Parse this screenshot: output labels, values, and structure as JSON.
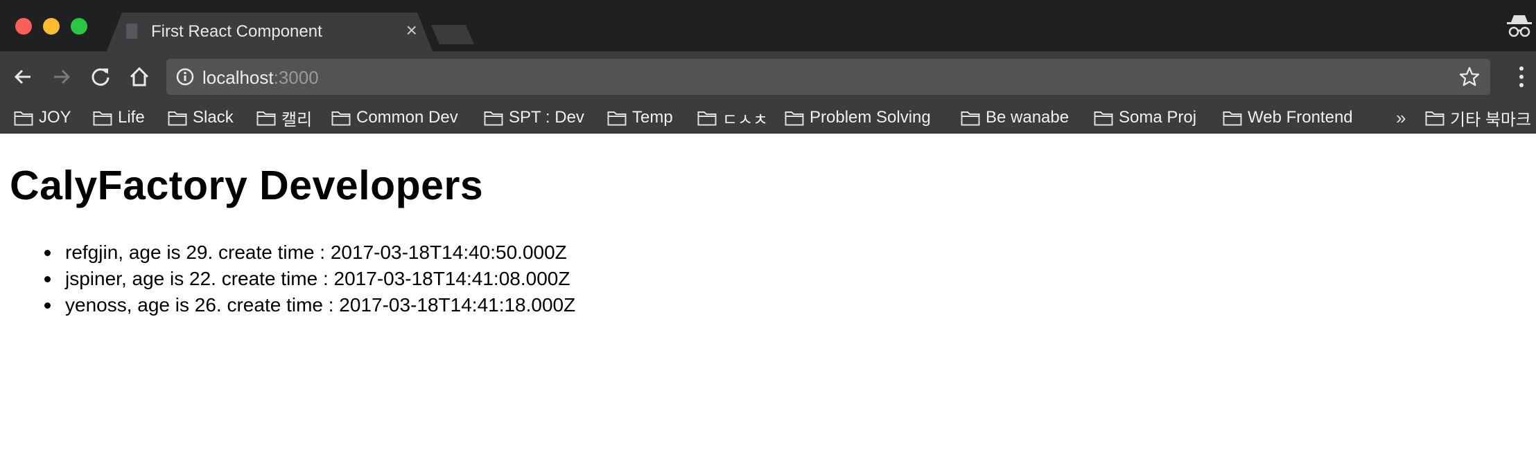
{
  "window": {
    "tab_title": "First React Component",
    "tab_close": "×"
  },
  "toolbar": {
    "url_host": "localhost",
    "url_port": ":3000"
  },
  "bookmarks": {
    "items": [
      "JOY",
      "Life",
      "Slack",
      "캘리",
      "Common Dev",
      "SPT : Dev",
      "Temp",
      "ㄷㅅㅊ",
      "Problem Solving",
      "Be wanabe",
      "Soma Proj",
      "Web Frontend"
    ],
    "overflow": "»",
    "other": "기타 북마크"
  },
  "page": {
    "heading": "CalyFactory Developers",
    "list": [
      "refgjin, age is 29. create time : 2017-03-18T14:40:50.000Z",
      "jspiner, age is 22. create time : 2017-03-18T14:41:08.000Z",
      "yenoss, age is 26. create time : 2017-03-18T14:41:18.000Z"
    ]
  },
  "icons": [
    "back-icon",
    "forward-icon",
    "reload-icon",
    "home-icon",
    "info-icon",
    "star-icon",
    "menu-icon",
    "incognito-icon",
    "folder-icon",
    "page-icon"
  ]
}
